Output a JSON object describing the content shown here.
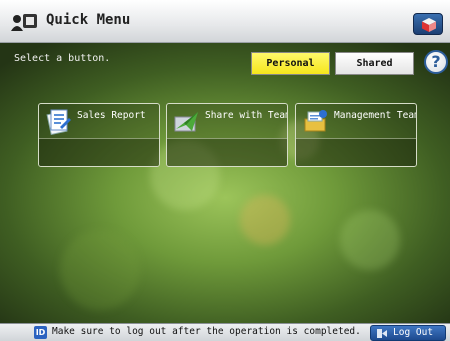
{
  "header": {
    "title": "Quick Menu",
    "menu_icon": "quick-menu-icon",
    "corner_icon": "cube-icon"
  },
  "instruction": "Select a button.",
  "toggle": {
    "personal": "Personal",
    "shared": "Shared",
    "selected": "Personal"
  },
  "help_label": "?",
  "tiles": [
    {
      "label": "Sales Report",
      "icon": "document-report-icon"
    },
    {
      "label": "Share with Team",
      "icon": "share-plane-icon"
    },
    {
      "label": "Management Team",
      "icon": "tray-folder-icon"
    }
  ],
  "footer": {
    "id_badge": "ID",
    "notice": "Make sure to log out after the operation is completed.",
    "logout_label": "Log Out"
  },
  "colors": {
    "accent_yellow": "#f5e61c",
    "brand_blue": "#2c5d9a"
  }
}
